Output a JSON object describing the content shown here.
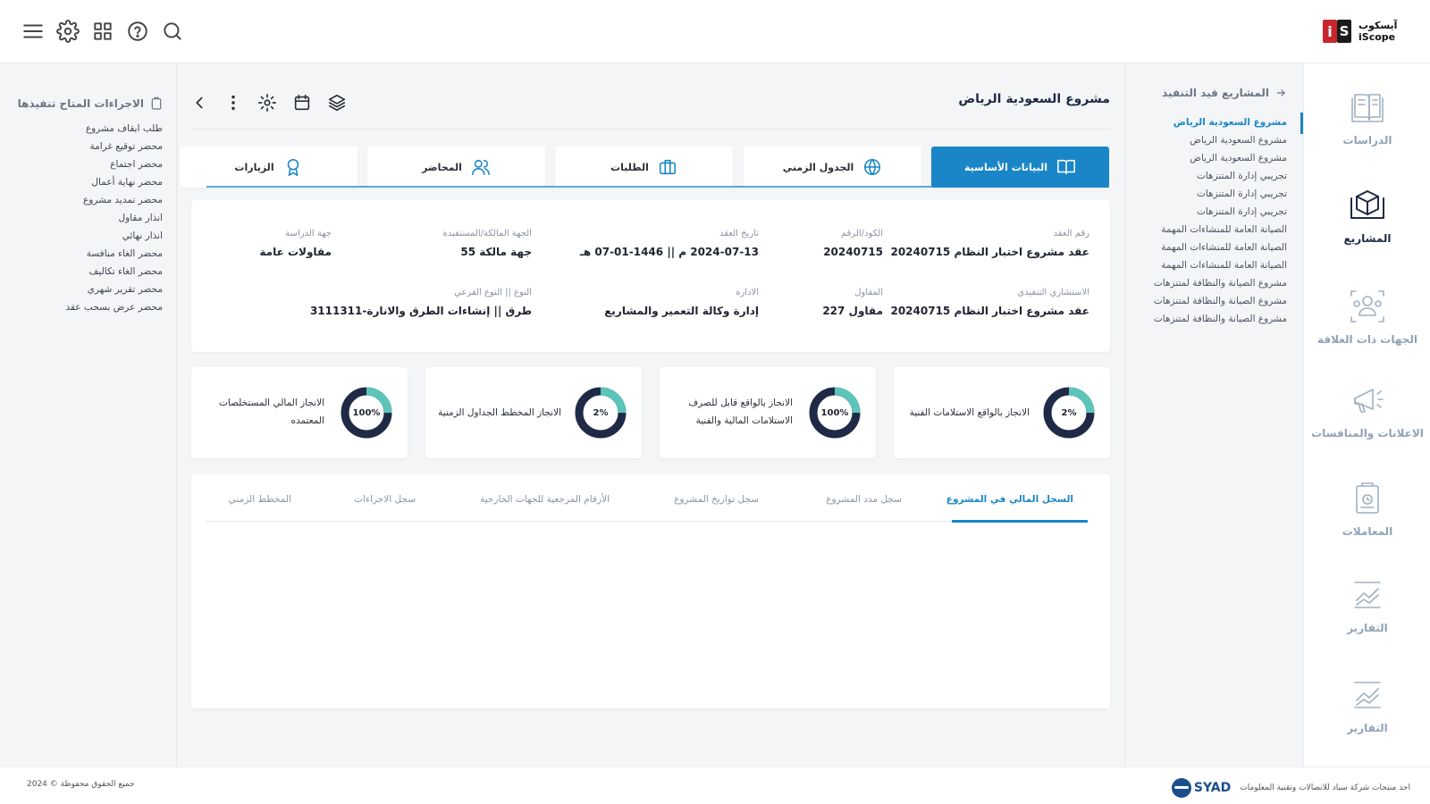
{
  "brand": {
    "name_ar": "آيسكوب",
    "name_en": "iScope",
    "logo_letters": [
      "i",
      "S"
    ]
  },
  "colors": {
    "accent": "#1a86c7",
    "navy": "#1f2b46",
    "teal": "#5cc4b8"
  },
  "header": {
    "icons": [
      "menu-icon",
      "gear-icon",
      "grid-icon",
      "help-icon",
      "search-icon"
    ]
  },
  "rail": {
    "items": [
      {
        "label": "الدراسات",
        "icon": "book-icon"
      },
      {
        "label": "المشاريع",
        "icon": "box-icon",
        "active": true
      },
      {
        "label": "الجهات ذات العلاقة",
        "icon": "people-icon"
      },
      {
        "label": "الاعلانات والمنافسات",
        "icon": "megaphone-icon"
      },
      {
        "label": "المعاملات",
        "icon": "clipboard-icon"
      },
      {
        "label": "التقارير",
        "icon": "chart-icon"
      },
      {
        "label": "التقارير",
        "icon": "chart-icon"
      }
    ]
  },
  "projects": {
    "title": "المشاريع قيد التنفيذ",
    "items": [
      "مشروع السعودية الرياض",
      "مشروع السعودية الرياض",
      "مشروع السعودية الرياض",
      "تجريبي إدارة المتنزهات",
      "تجريبي إدارة المتنزهات",
      "تجريبي إدارة المتنزهات",
      "الصيانة العامة للمنشاءات المهمة",
      "الصيانة العامة للمنشاءات المهمة",
      "الصيانة العامة للمنشاءات المهمة",
      "مشروع الصيانة والنظافة لمتنزهات",
      "مشروع الصيانة والنظافة لمتنزهات",
      "مشروع الصيانة والنظافة لمتنزهات"
    ]
  },
  "page": {
    "title": "مشروع السعودية الرياض"
  },
  "toolbar": {
    "icons": [
      "layers-icon",
      "calendar-icon",
      "gear-icon",
      "more-vertical-icon",
      "chevron-left-icon"
    ]
  },
  "tabs": [
    {
      "label": "البيانات الأساسية",
      "icon": "book-open-icon",
      "active": true
    },
    {
      "label": "الجدول الزمني",
      "icon": "globe-icon"
    },
    {
      "label": "الطلبات",
      "icon": "briefcase-icon"
    },
    {
      "label": "المحاضر",
      "icon": "users-icon"
    },
    {
      "label": "الزيارات",
      "icon": "award-icon"
    }
  ],
  "info": {
    "contract_no": {
      "label": "رقم العقد",
      "value": "عقد مشروع اختبار النظام 20240715"
    },
    "code": {
      "label": "الكود/الرقم",
      "value": "20240715"
    },
    "contract_date": {
      "label": "تاريخ العقد",
      "value": "2024-07-13 م || 1446-01-07 هـ"
    },
    "owner": {
      "label": "الجهة المالكة/المستفيدة",
      "value": "جهة مالكة 55"
    },
    "study_party": {
      "label": "جهة الدراسة",
      "value": "مقاولات عامة"
    },
    "consultant": {
      "label": "الاستشاري التنفيذي",
      "value": "عقد مشروع اختبار النظام 20240715"
    },
    "contractor": {
      "label": "المقاول",
      "value": "مقاول 227"
    },
    "department": {
      "label": "الادارة",
      "value": "إدارة وكالة التعمير والمشاريع"
    },
    "type": {
      "label": "النوع || النوع الفرعي",
      "value": "طرق || إنشاءات الطرق والانارة-3111311"
    }
  },
  "stats": [
    {
      "label": "الانجاز بالواقع الاستلامات الفنية",
      "percent": 2,
      "text": "2%"
    },
    {
      "label": "الانجاز بالواقع قابل للصرف الاستلامات المالية والفنية",
      "label_lines": [
        "الانجاز بالواقع قابل للصرف",
        "الاستلامات المالية والفنية"
      ],
      "percent": 100,
      "text": "100%"
    },
    {
      "label": "الانجاز المخطط الجداول الزمنية",
      "percent": 2,
      "text": "2%"
    },
    {
      "label": "الانجاز المالي المستخلصات المعتمده",
      "label_lines": [
        "الانجاز المالي المستخلصات",
        "المعتمده"
      ],
      "percent": 100,
      "text": "100%"
    }
  ],
  "log_tabs": [
    {
      "label": "السجل المالي في المشروع",
      "active": true
    },
    {
      "label": "سجل مدد المشروع"
    },
    {
      "label": "سجل تواريخ المشروع"
    },
    {
      "label": "الأرقام المرجعية للجهات الخارجية"
    },
    {
      "label": "سجل الاجراءات"
    },
    {
      "label": "المخطط الزمني"
    }
  ],
  "actions": {
    "title": "الاجراءات المتاح تنفيذها",
    "items": [
      "طلب ايقاف مشروع",
      "محضر توقيع غرامة",
      "محضر اجتماع",
      "محضر نهاية أعمال",
      "محضر تمديد مشروع",
      "انذار مقاول",
      "انذار نهائي",
      "محضر الغاء منافسة",
      "محضر الغاء تكاليف",
      "محضر تقرير شهري",
      "محضر عرض بسحب عقد"
    ]
  },
  "footer": {
    "company_text": "احد منتجات شركة سياد للاتصالات وتقنية المعلومات",
    "company_logo": "SYAD",
    "copyright": "جميع الحقوق محفوظة © 2024"
  }
}
